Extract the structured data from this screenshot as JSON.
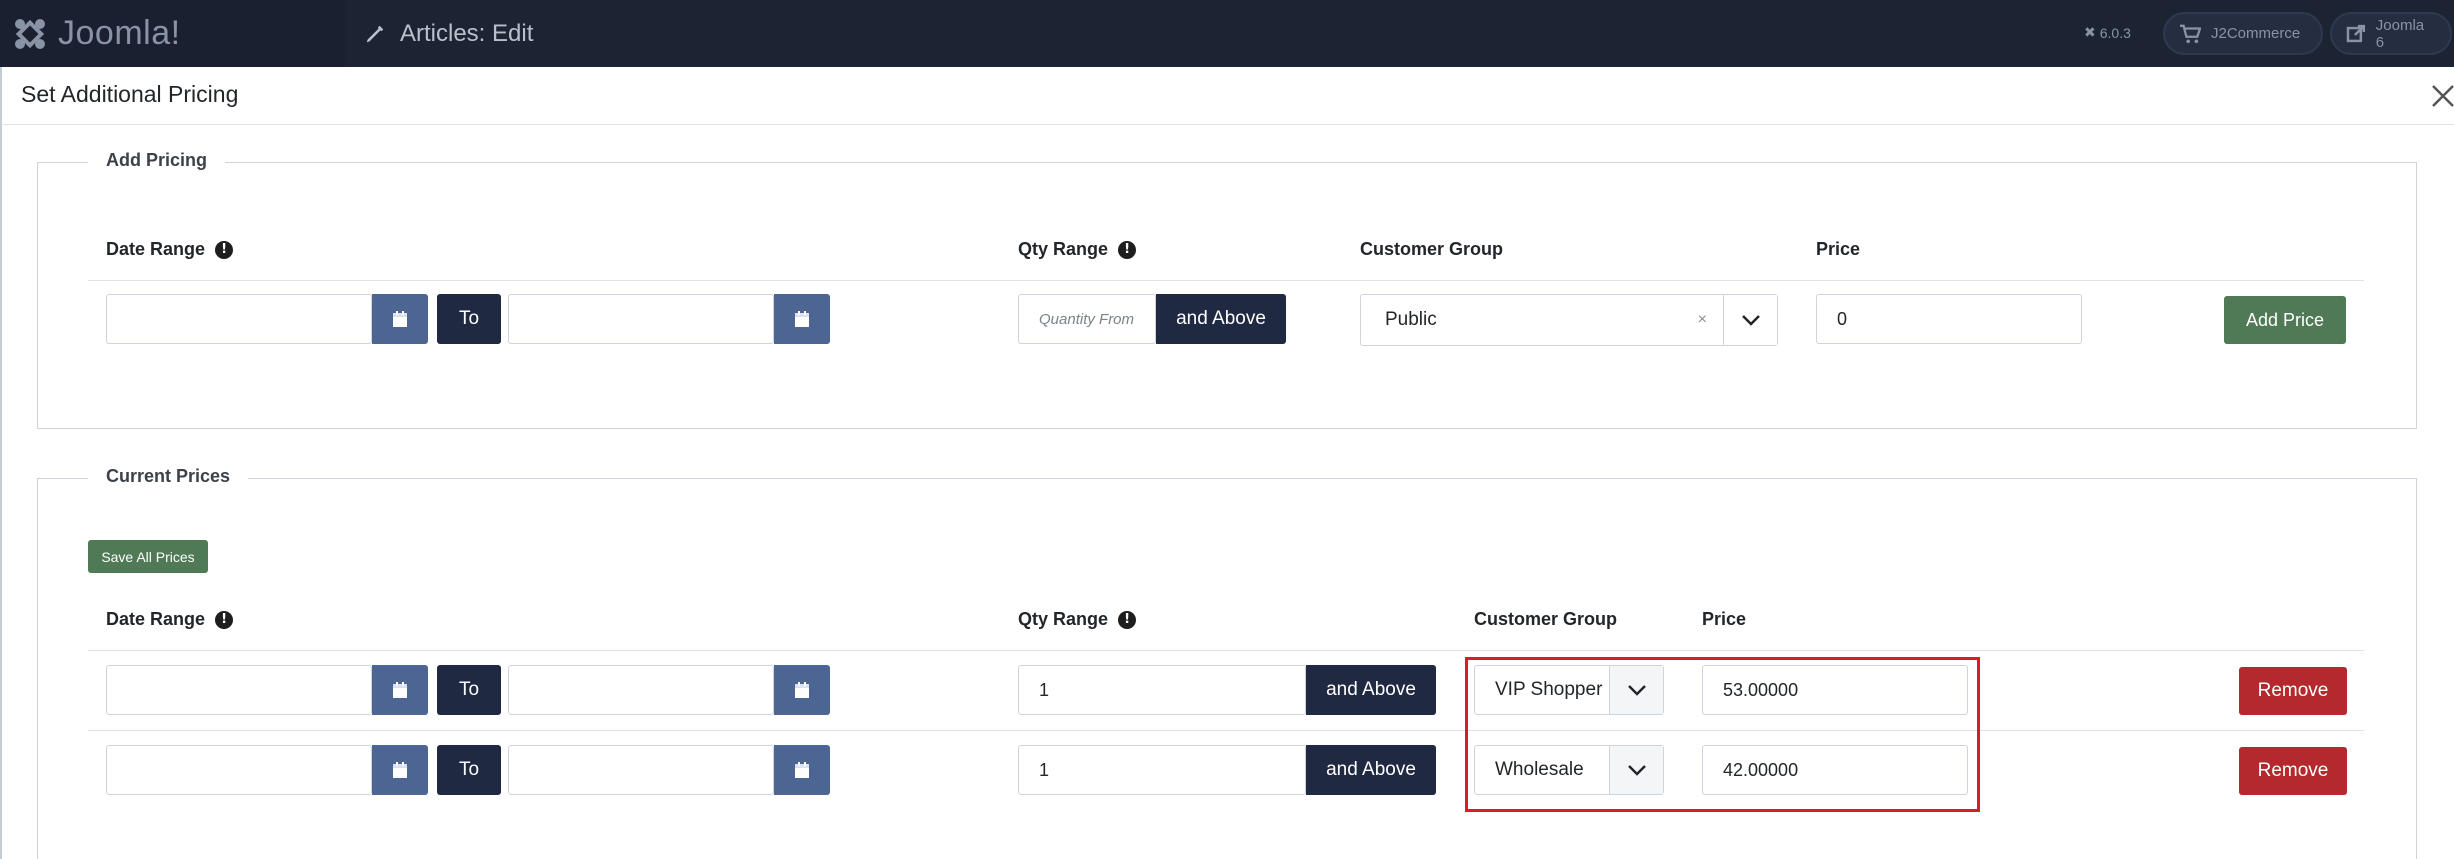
{
  "topbar": {
    "logo_text": "Joomla!",
    "title": "Articles: Edit",
    "version": "6.0.3",
    "pills": [
      {
        "label": "J2Commerce",
        "icon": "cart-icon"
      },
      {
        "label": "Joomla 6",
        "icon": "external-link-icon"
      }
    ]
  },
  "modal": {
    "title": "Set Additional Pricing",
    "add_pricing": {
      "legend": "Add Pricing",
      "headers": {
        "date_range": "Date Range",
        "qty_range": "Qty Range",
        "customer_group": "Customer Group",
        "price": "Price"
      },
      "to_label": "To",
      "qty_placeholder": "Quantity From",
      "and_above_label": "and Above",
      "customer_group_value": "Public",
      "clear_symbol": "×",
      "price_value": "0",
      "add_button": "Add Price"
    },
    "current_prices": {
      "legend": "Current Prices",
      "save_all_button": "Save All Prices",
      "headers": {
        "date_range": "Date Range",
        "qty_range": "Qty Range",
        "customer_group": "Customer Group",
        "price": "Price"
      },
      "rows": [
        {
          "to_label": "To",
          "qty": "1",
          "and_above": "and Above",
          "customer_group": "VIP Shopper",
          "price": "53.00000",
          "remove": "Remove"
        },
        {
          "to_label": "To",
          "qty": "1",
          "and_above": "and Above",
          "customer_group": "Wholesale",
          "price": "42.00000",
          "remove": "Remove"
        }
      ]
    }
  },
  "colors": {
    "topbar_bg": "#1c2333",
    "calendar_button": "#4c6592",
    "dark_button": "#1f2a42",
    "green_button": "#4f7a55",
    "remove_button": "#b3292e",
    "highlight_border": "#d71e28"
  }
}
